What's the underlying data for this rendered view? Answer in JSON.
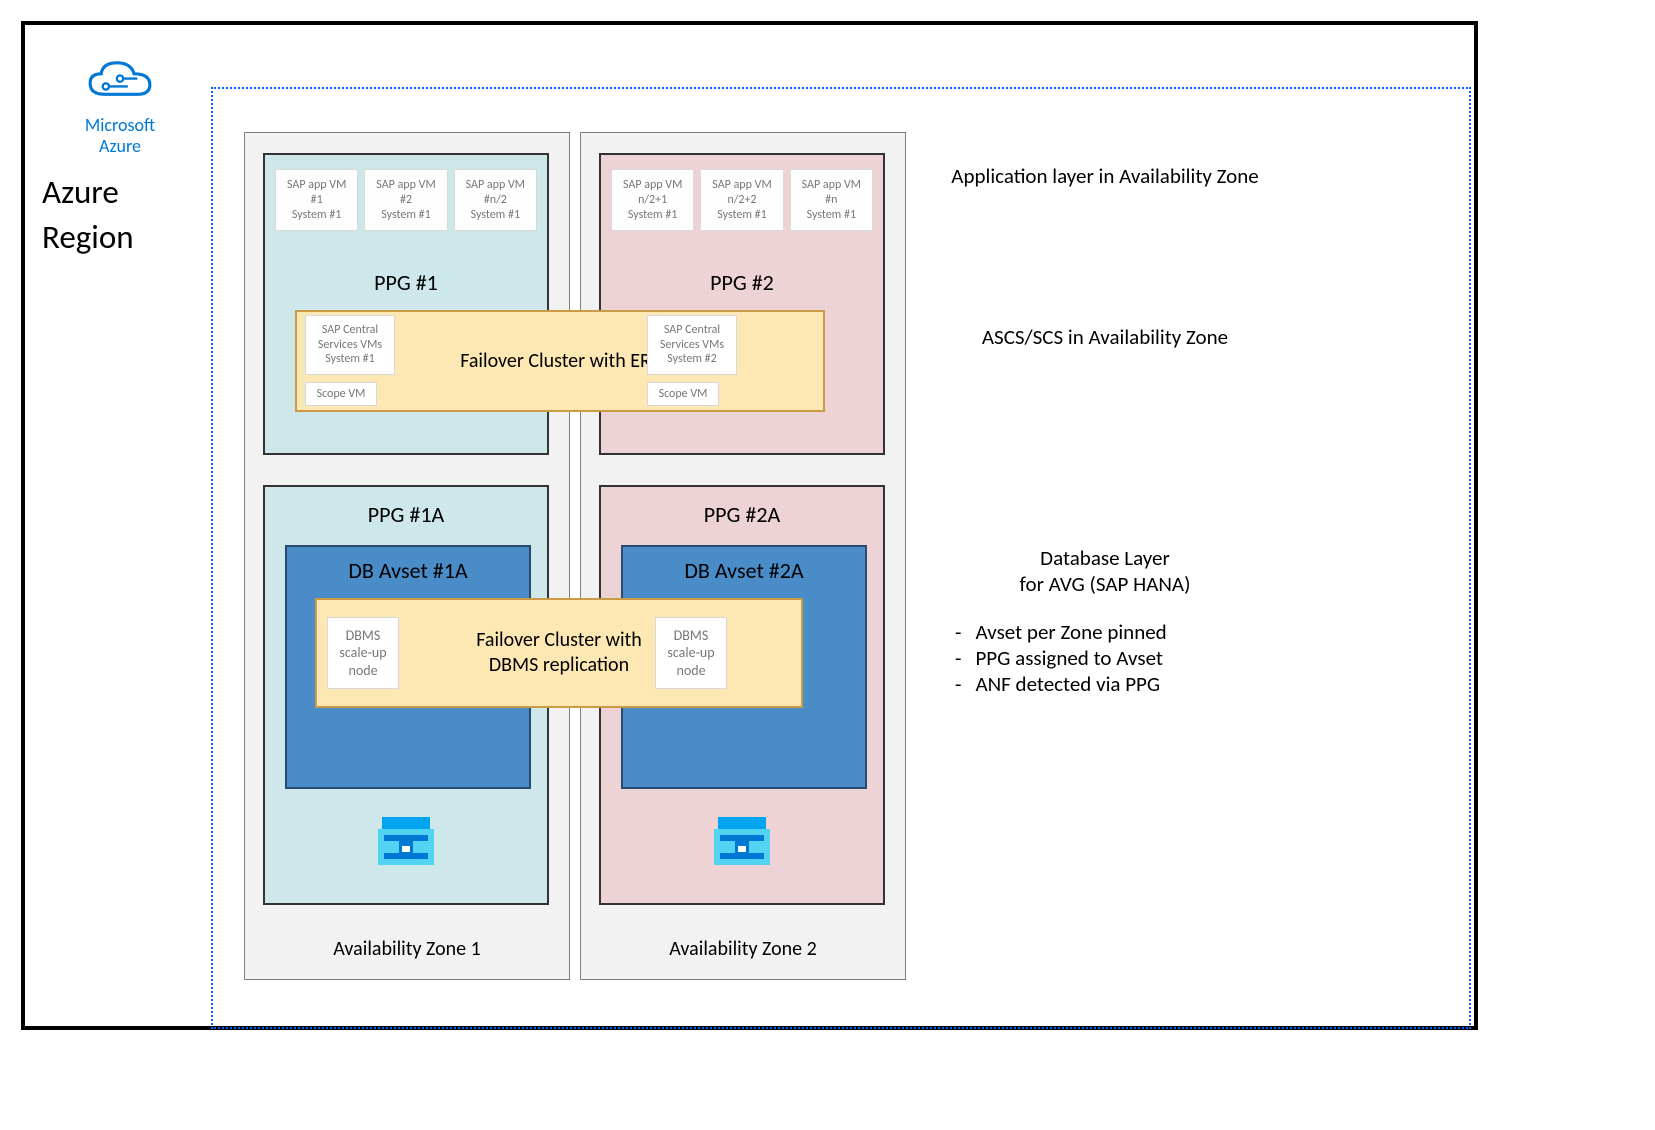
{
  "branding": {
    "line1": "Microsoft",
    "line2": "Azure"
  },
  "region_label": "Azure Region",
  "zones": {
    "az1": {
      "label": "Availability Zone 1"
    },
    "az2": {
      "label": "Availability Zone 2"
    }
  },
  "ppg": {
    "top1": {
      "label": "PPG #1"
    },
    "top2": {
      "label": "PPG #2"
    },
    "bot1": {
      "label": "PPG #1A"
    },
    "bot2": {
      "label": "PPG #2A"
    }
  },
  "vms": {
    "z1": {
      "a": {
        "l1": "SAP app VM",
        "l2": "#1",
        "l3": "System #1"
      },
      "b": {
        "l1": "SAP app VM",
        "l2": "#2",
        "l3": "System #1"
      },
      "c": {
        "l1": "SAP app VM",
        "l2": "#n/2",
        "l3": "System #1"
      }
    },
    "z2": {
      "a": {
        "l1": "SAP app VM",
        "l2": "n/2+1",
        "l3": "System #1"
      },
      "b": {
        "l1": "SAP app VM",
        "l2": "n/2+2",
        "l3": "System #1"
      },
      "c": {
        "l1": "SAP app VM",
        "l2": "#n",
        "l3": "System #1"
      }
    }
  },
  "central_services": {
    "z1": {
      "l1": "SAP Central",
      "l2": "Services VMs",
      "l3": "System #1"
    },
    "z2": {
      "l1": "SAP Central",
      "l2": "Services VMs",
      "l3": "System #2"
    }
  },
  "scope": {
    "z1": "Scope VM",
    "z2": "Scope VM"
  },
  "failover": {
    "ers": "Failover Cluster with ERS",
    "db_line1": "Failover Cluster with",
    "db_line2": "DBMS replication"
  },
  "db_avset": {
    "z1": "DB Avset #1A",
    "z2": "DB Avset #2A"
  },
  "dbms_node": {
    "z1_l1": "DBMS",
    "z1_l2": "scale-up",
    "z1_l3": "node",
    "z2_l1": "DBMS",
    "z2_l2": "scale-up",
    "z2_l3": "node"
  },
  "annotations": {
    "app_layer": "Application layer in Availability Zone",
    "ascs": "ASCS/SCS in Availability Zone",
    "db_title_l1": "Database Layer",
    "db_title_l2": "for AVG (SAP HANA)",
    "bullets": {
      "b1": "Avset per Zone pinned",
      "b2": "PPG assigned to Avset",
      "b3": "ANF detected via PPG"
    }
  }
}
